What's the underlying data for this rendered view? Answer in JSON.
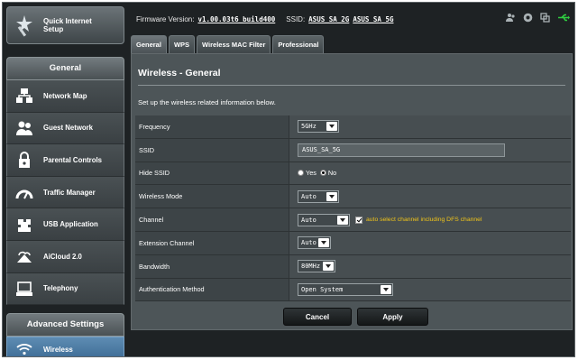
{
  "sidebar": {
    "quick_setup": "Quick Internet\nSetup",
    "general_header": "General",
    "items": [
      {
        "label": "Network Map",
        "icon": "network-map-icon"
      },
      {
        "label": "Guest Network",
        "icon": "guest-network-icon"
      },
      {
        "label": "Parental Controls",
        "icon": "parental-controls-icon"
      },
      {
        "label": "Traffic Manager",
        "icon": "traffic-manager-icon"
      },
      {
        "label": "USB Application",
        "icon": "usb-application-icon"
      },
      {
        "label": "AiCloud 2.0",
        "icon": "aicloud-icon"
      },
      {
        "label": "Telephony",
        "icon": "telephony-icon"
      }
    ],
    "advanced_header": "Advanced Settings",
    "advanced_items": [
      {
        "label": "Wireless",
        "icon": "wireless-icon",
        "active": true
      }
    ]
  },
  "header": {
    "firmware_label": "Firmware Version:",
    "firmware_value": "v1.00.03t6_build400",
    "ssid_label": "SSID:",
    "ssid_1": "ASUS_SA_2G",
    "ssid_2": "ASUS_SA_5G",
    "status_icons": [
      "users-icon",
      "globe-icon",
      "copy-icon",
      "usb-icon"
    ]
  },
  "tabs": [
    {
      "label": "General",
      "active": true
    },
    {
      "label": "WPS"
    },
    {
      "label": "Wireless MAC Filter"
    },
    {
      "label": "Professional"
    }
  ],
  "main": {
    "title": "Wireless - General",
    "description": "Set up the wireless related information below.",
    "fields": {
      "frequency": {
        "label": "Frequency",
        "value": "5GHz"
      },
      "ssid": {
        "label": "SSID",
        "value": "ASUS_SA_5G"
      },
      "hide_ssid": {
        "label": "Hide SSID",
        "yes": "Yes",
        "no": "No",
        "selected": "No"
      },
      "wireless_mode": {
        "label": "Wireless Mode",
        "value": "Auto"
      },
      "channel": {
        "label": "Channel",
        "value": "Auto",
        "dfs_label": "auto select channel including DFS channel",
        "dfs_checked": true
      },
      "extension_channel": {
        "label": "Extension Channel",
        "value": "Auto"
      },
      "bandwidth": {
        "label": "Bandwidth",
        "value": "80MHz"
      },
      "auth_method": {
        "label": "Authentication Method",
        "value": "Open System"
      }
    },
    "buttons": {
      "cancel": "Cancel",
      "apply": "Apply"
    }
  },
  "colors": {
    "accent_active": "#4a7aa3",
    "dfs_text": "#f0c419",
    "usb_status": "#2ecc40"
  }
}
